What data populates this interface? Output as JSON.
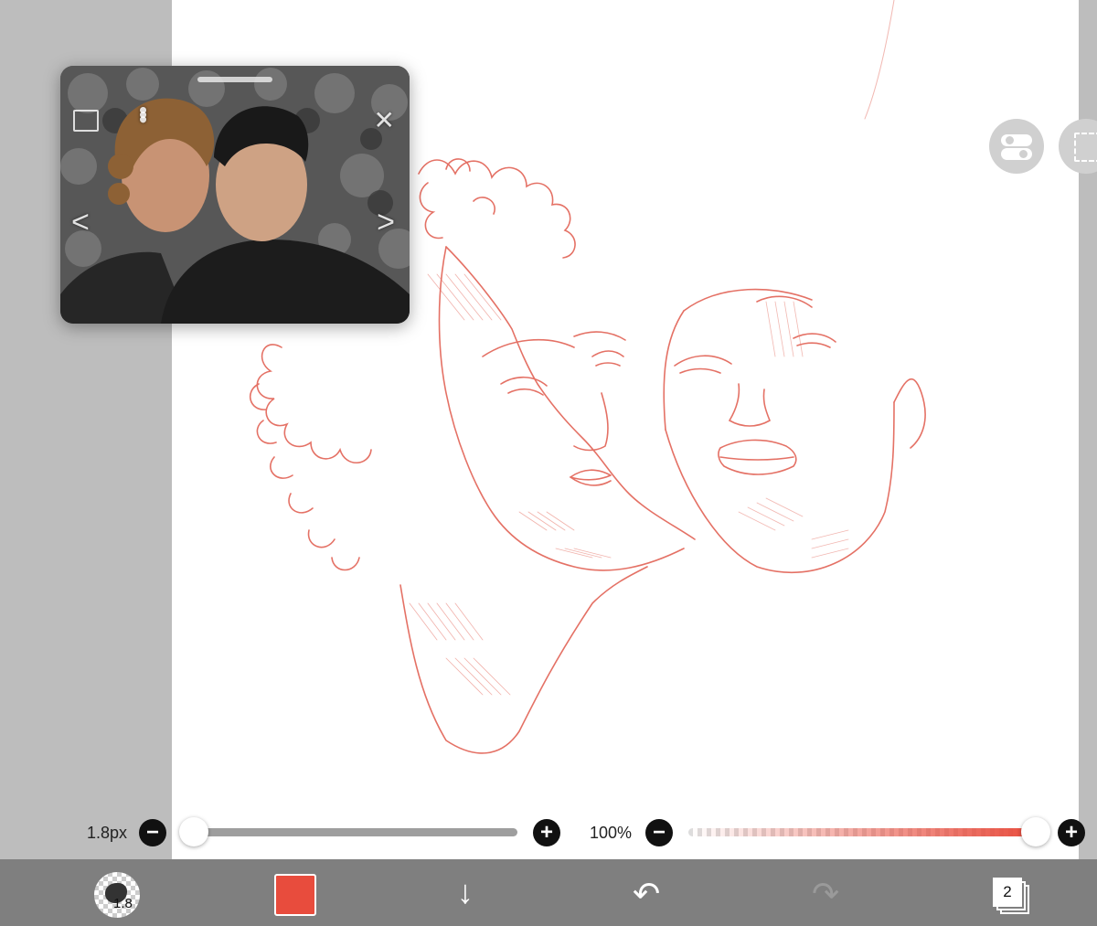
{
  "reference_window": {
    "icons": [
      "image-icon",
      "more-vertical-icon",
      "close-icon",
      "chevron-left-icon",
      "chevron-right-icon"
    ],
    "close_glyph": "✕",
    "prev_glyph": "<",
    "next_glyph": ">",
    "more_glyph": "•••"
  },
  "brush_slider": {
    "label": "1.8px",
    "minus": "−",
    "plus": "+",
    "level": 0.0
  },
  "opacity_slider": {
    "label": "100%",
    "minus": "−",
    "plus": "+",
    "level": 1.0,
    "color": "#e84c3d"
  },
  "toolbar": {
    "brush_size": "1.8",
    "current_color": "#e84c3d",
    "down_glyph": "↓",
    "undo_glyph": "↶",
    "redo_glyph": "↷",
    "layer_count": "2"
  }
}
